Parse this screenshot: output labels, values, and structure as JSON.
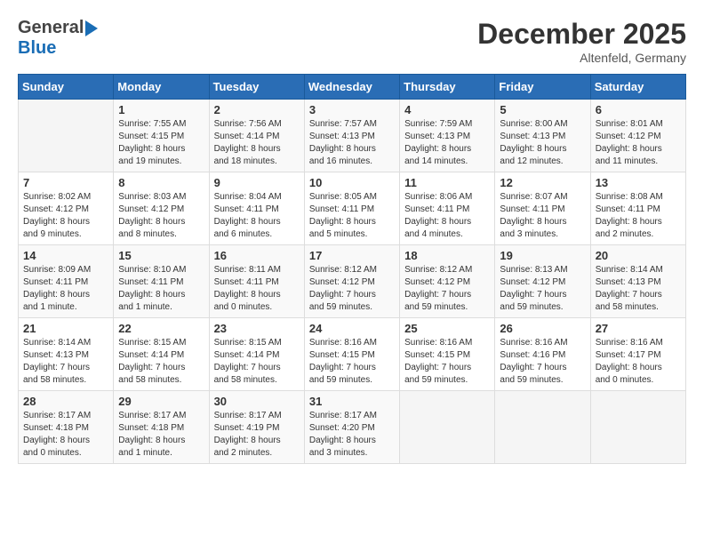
{
  "header": {
    "logo_general": "General",
    "logo_blue": "Blue",
    "month_title": "December 2025",
    "location": "Altenfeld, Germany"
  },
  "calendar": {
    "days": [
      "Sunday",
      "Monday",
      "Tuesday",
      "Wednesday",
      "Thursday",
      "Friday",
      "Saturday"
    ],
    "weeks": [
      [
        {
          "day": "",
          "info": ""
        },
        {
          "day": "1",
          "info": "Sunrise: 7:55 AM\nSunset: 4:15 PM\nDaylight: 8 hours\nand 19 minutes."
        },
        {
          "day": "2",
          "info": "Sunrise: 7:56 AM\nSunset: 4:14 PM\nDaylight: 8 hours\nand 18 minutes."
        },
        {
          "day": "3",
          "info": "Sunrise: 7:57 AM\nSunset: 4:13 PM\nDaylight: 8 hours\nand 16 minutes."
        },
        {
          "day": "4",
          "info": "Sunrise: 7:59 AM\nSunset: 4:13 PM\nDaylight: 8 hours\nand 14 minutes."
        },
        {
          "day": "5",
          "info": "Sunrise: 8:00 AM\nSunset: 4:13 PM\nDaylight: 8 hours\nand 12 minutes."
        },
        {
          "day": "6",
          "info": "Sunrise: 8:01 AM\nSunset: 4:12 PM\nDaylight: 8 hours\nand 11 minutes."
        }
      ],
      [
        {
          "day": "7",
          "info": "Sunrise: 8:02 AM\nSunset: 4:12 PM\nDaylight: 8 hours\nand 9 minutes."
        },
        {
          "day": "8",
          "info": "Sunrise: 8:03 AM\nSunset: 4:12 PM\nDaylight: 8 hours\nand 8 minutes."
        },
        {
          "day": "9",
          "info": "Sunrise: 8:04 AM\nSunset: 4:11 PM\nDaylight: 8 hours\nand 6 minutes."
        },
        {
          "day": "10",
          "info": "Sunrise: 8:05 AM\nSunset: 4:11 PM\nDaylight: 8 hours\nand 5 minutes."
        },
        {
          "day": "11",
          "info": "Sunrise: 8:06 AM\nSunset: 4:11 PM\nDaylight: 8 hours\nand 4 minutes."
        },
        {
          "day": "12",
          "info": "Sunrise: 8:07 AM\nSunset: 4:11 PM\nDaylight: 8 hours\nand 3 minutes."
        },
        {
          "day": "13",
          "info": "Sunrise: 8:08 AM\nSunset: 4:11 PM\nDaylight: 8 hours\nand 2 minutes."
        }
      ],
      [
        {
          "day": "14",
          "info": "Sunrise: 8:09 AM\nSunset: 4:11 PM\nDaylight: 8 hours\nand 1 minute."
        },
        {
          "day": "15",
          "info": "Sunrise: 8:10 AM\nSunset: 4:11 PM\nDaylight: 8 hours\nand 1 minute."
        },
        {
          "day": "16",
          "info": "Sunrise: 8:11 AM\nSunset: 4:11 PM\nDaylight: 8 hours\nand 0 minutes."
        },
        {
          "day": "17",
          "info": "Sunrise: 8:12 AM\nSunset: 4:12 PM\nDaylight: 7 hours\nand 59 minutes."
        },
        {
          "day": "18",
          "info": "Sunrise: 8:12 AM\nSunset: 4:12 PM\nDaylight: 7 hours\nand 59 minutes."
        },
        {
          "day": "19",
          "info": "Sunrise: 8:13 AM\nSunset: 4:12 PM\nDaylight: 7 hours\nand 59 minutes."
        },
        {
          "day": "20",
          "info": "Sunrise: 8:14 AM\nSunset: 4:13 PM\nDaylight: 7 hours\nand 58 minutes."
        }
      ],
      [
        {
          "day": "21",
          "info": "Sunrise: 8:14 AM\nSunset: 4:13 PM\nDaylight: 7 hours\nand 58 minutes."
        },
        {
          "day": "22",
          "info": "Sunrise: 8:15 AM\nSunset: 4:14 PM\nDaylight: 7 hours\nand 58 minutes."
        },
        {
          "day": "23",
          "info": "Sunrise: 8:15 AM\nSunset: 4:14 PM\nDaylight: 7 hours\nand 58 minutes."
        },
        {
          "day": "24",
          "info": "Sunrise: 8:16 AM\nSunset: 4:15 PM\nDaylight: 7 hours\nand 59 minutes."
        },
        {
          "day": "25",
          "info": "Sunrise: 8:16 AM\nSunset: 4:15 PM\nDaylight: 7 hours\nand 59 minutes."
        },
        {
          "day": "26",
          "info": "Sunrise: 8:16 AM\nSunset: 4:16 PM\nDaylight: 7 hours\nand 59 minutes."
        },
        {
          "day": "27",
          "info": "Sunrise: 8:16 AM\nSunset: 4:17 PM\nDaylight: 8 hours\nand 0 minutes."
        }
      ],
      [
        {
          "day": "28",
          "info": "Sunrise: 8:17 AM\nSunset: 4:18 PM\nDaylight: 8 hours\nand 0 minutes."
        },
        {
          "day": "29",
          "info": "Sunrise: 8:17 AM\nSunset: 4:18 PM\nDaylight: 8 hours\nand 1 minute."
        },
        {
          "day": "30",
          "info": "Sunrise: 8:17 AM\nSunset: 4:19 PM\nDaylight: 8 hours\nand 2 minutes."
        },
        {
          "day": "31",
          "info": "Sunrise: 8:17 AM\nSunset: 4:20 PM\nDaylight: 8 hours\nand 3 minutes."
        },
        {
          "day": "",
          "info": ""
        },
        {
          "day": "",
          "info": ""
        },
        {
          "day": "",
          "info": ""
        }
      ]
    ]
  }
}
